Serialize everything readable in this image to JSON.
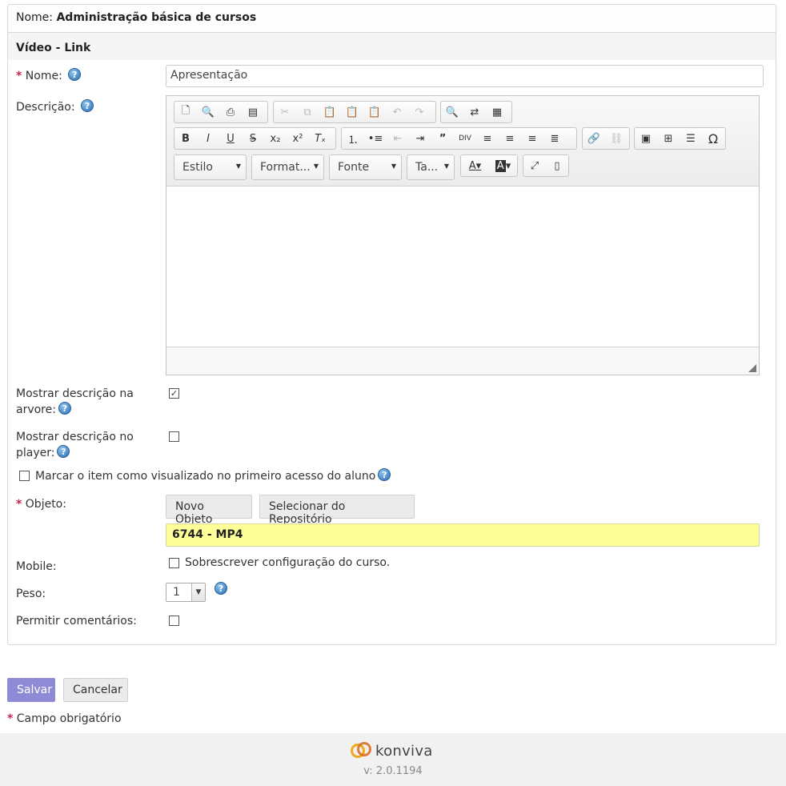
{
  "header": {
    "name_label": "Nome:",
    "name_value": "Administração básica de cursos"
  },
  "panel": {
    "title": "Vídeo - Link"
  },
  "form": {
    "required_mark": "*",
    "help_glyph": "?",
    "nome_label": "Nome:",
    "nome_value": "Apresentação",
    "descricao_label": "Descrição:",
    "mostrar_arvore_label_1": "Mostrar descrição na",
    "mostrar_arvore_label_2": "arvore:",
    "mostrar_arvore_checked": true,
    "mostrar_player_label_1": "Mostrar descrição no",
    "mostrar_player_label_2": "player:",
    "mostrar_player_checked": false,
    "marcar_label": "Marcar o item como visualizado no primeiro acesso do aluno",
    "objeto_label": "Objeto:",
    "novo_objeto_button": "Novo Objeto",
    "selecionar_button": "Selecionar do Repositório",
    "objeto_value": "6744 - MP4",
    "mobile_label": "Mobile:",
    "mobile_option_label": "Sobrescrever configuração do curso.",
    "peso_label": "Peso:",
    "peso_value": "1",
    "comentarios_label": "Permitir comentários:"
  },
  "editor_toolbar": {
    "style_combo": "Estilo",
    "format_combo": "Format...",
    "font_combo": "Fonte",
    "size_combo": "Ta...",
    "icons": [
      "new-page-icon",
      "preview-icon",
      "print-icon",
      "templates-icon",
      "cut-icon",
      "copy-icon",
      "paste-icon",
      "paste-text-icon",
      "paste-word-icon",
      "undo-icon",
      "redo-icon",
      "find-icon",
      "replace-icon",
      "select-all-icon",
      "bold-icon",
      "italic-icon",
      "underline-icon",
      "strike-icon",
      "subscript-icon",
      "superscript-icon",
      "remove-format-icon",
      "numbered-list-icon",
      "bulleted-list-icon",
      "outdent-icon",
      "indent-icon",
      "blockquote-icon",
      "div-icon",
      "align-left-icon",
      "align-center-icon",
      "align-right-icon",
      "justify-icon",
      "link-icon",
      "unlink-icon",
      "image-icon",
      "table-icon",
      "horizontal-line-icon",
      "special-char-icon",
      "text-color-icon",
      "bg-color-icon",
      "maximize-icon",
      "show-blocks-icon"
    ]
  },
  "actions": {
    "save": "Salvar",
    "cancel": "Cancelar"
  },
  "legend": {
    "mark": "*",
    "text": "Campo obrigatório"
  },
  "footer": {
    "brand": "konviva",
    "version": "v: 2.0.1194"
  },
  "colors": {
    "save_button": "#8e8ad6",
    "object_highlight": "#ffff99",
    "required": "#c7254e"
  }
}
